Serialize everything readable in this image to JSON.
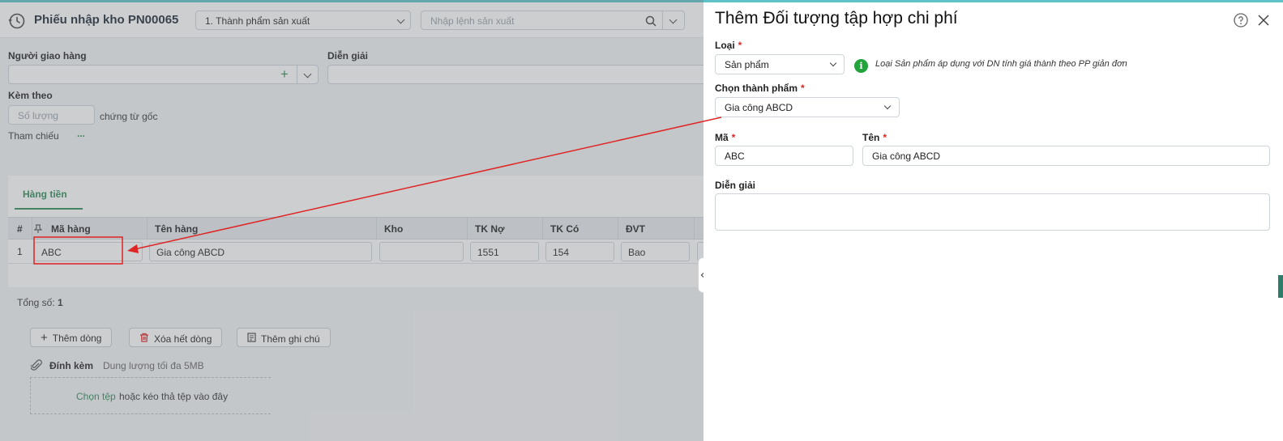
{
  "header": {
    "title": "Phiếu nhập kho PN00065",
    "type_select": "1. Thành phẩm sản xuất",
    "production_placeholder": "Nhập lệnh sản xuất"
  },
  "form": {
    "deliverer_label": "Người giao hàng",
    "description_label": "Diễn giải",
    "attach_label": "Kèm theo",
    "quantity_placeholder": "Số lượng",
    "original_docs": "chứng từ gốc",
    "reference_label": "Tham chiếu",
    "reference_more": "..."
  },
  "grid": {
    "tab": "Hàng tiền",
    "headers": [
      "#",
      "Mã hàng",
      "Tên hàng",
      "Kho",
      "TK Nợ",
      "TK Có",
      "ĐVT"
    ],
    "rows": [
      {
        "index": "1",
        "code": "ABC",
        "name": "Gia công ABCD",
        "warehouse": "",
        "debit": "1551",
        "credit": "154",
        "unit": "Bao"
      }
    ],
    "total_label": "Tổng số:",
    "total_value": "1"
  },
  "actions": {
    "add_row": "Thêm dòng",
    "delete_all": "Xóa hết dòng",
    "add_note": "Thêm ghi chú"
  },
  "attachment": {
    "label": "Đính kèm",
    "limit": "Dung lượng tối đa 5MB",
    "choose": "Chọn tệp",
    "drop_text": "hoặc kéo thả tệp vào đây"
  },
  "panel": {
    "title": "Thêm Đối tượng tập hợp chi phí",
    "type_label": "Loại",
    "type_value": "Sản phẩm",
    "type_hint": "Loại Sản phẩm áp dụng với DN tính giá thành theo PP giản đơn",
    "product_label": "Chọn thành phẩm",
    "product_value": "Gia công ABCD",
    "code_label": "Mã",
    "code_value": "ABC",
    "name_label": "Tên",
    "name_value": "Gia công ABCD",
    "desc_label": "Diễn giải",
    "required_mark": "*"
  },
  "colors": {
    "accent": "#2e8b57",
    "annotation": "#e02424",
    "info": "#22a33b"
  },
  "icons": [
    "clock-icon",
    "search-icon",
    "chevron-down-icon",
    "plus-icon",
    "trash-icon",
    "note-icon",
    "paperclip-icon",
    "help-icon",
    "close-icon",
    "pin-icon",
    "info-icon",
    "chevron-left-icon"
  ]
}
